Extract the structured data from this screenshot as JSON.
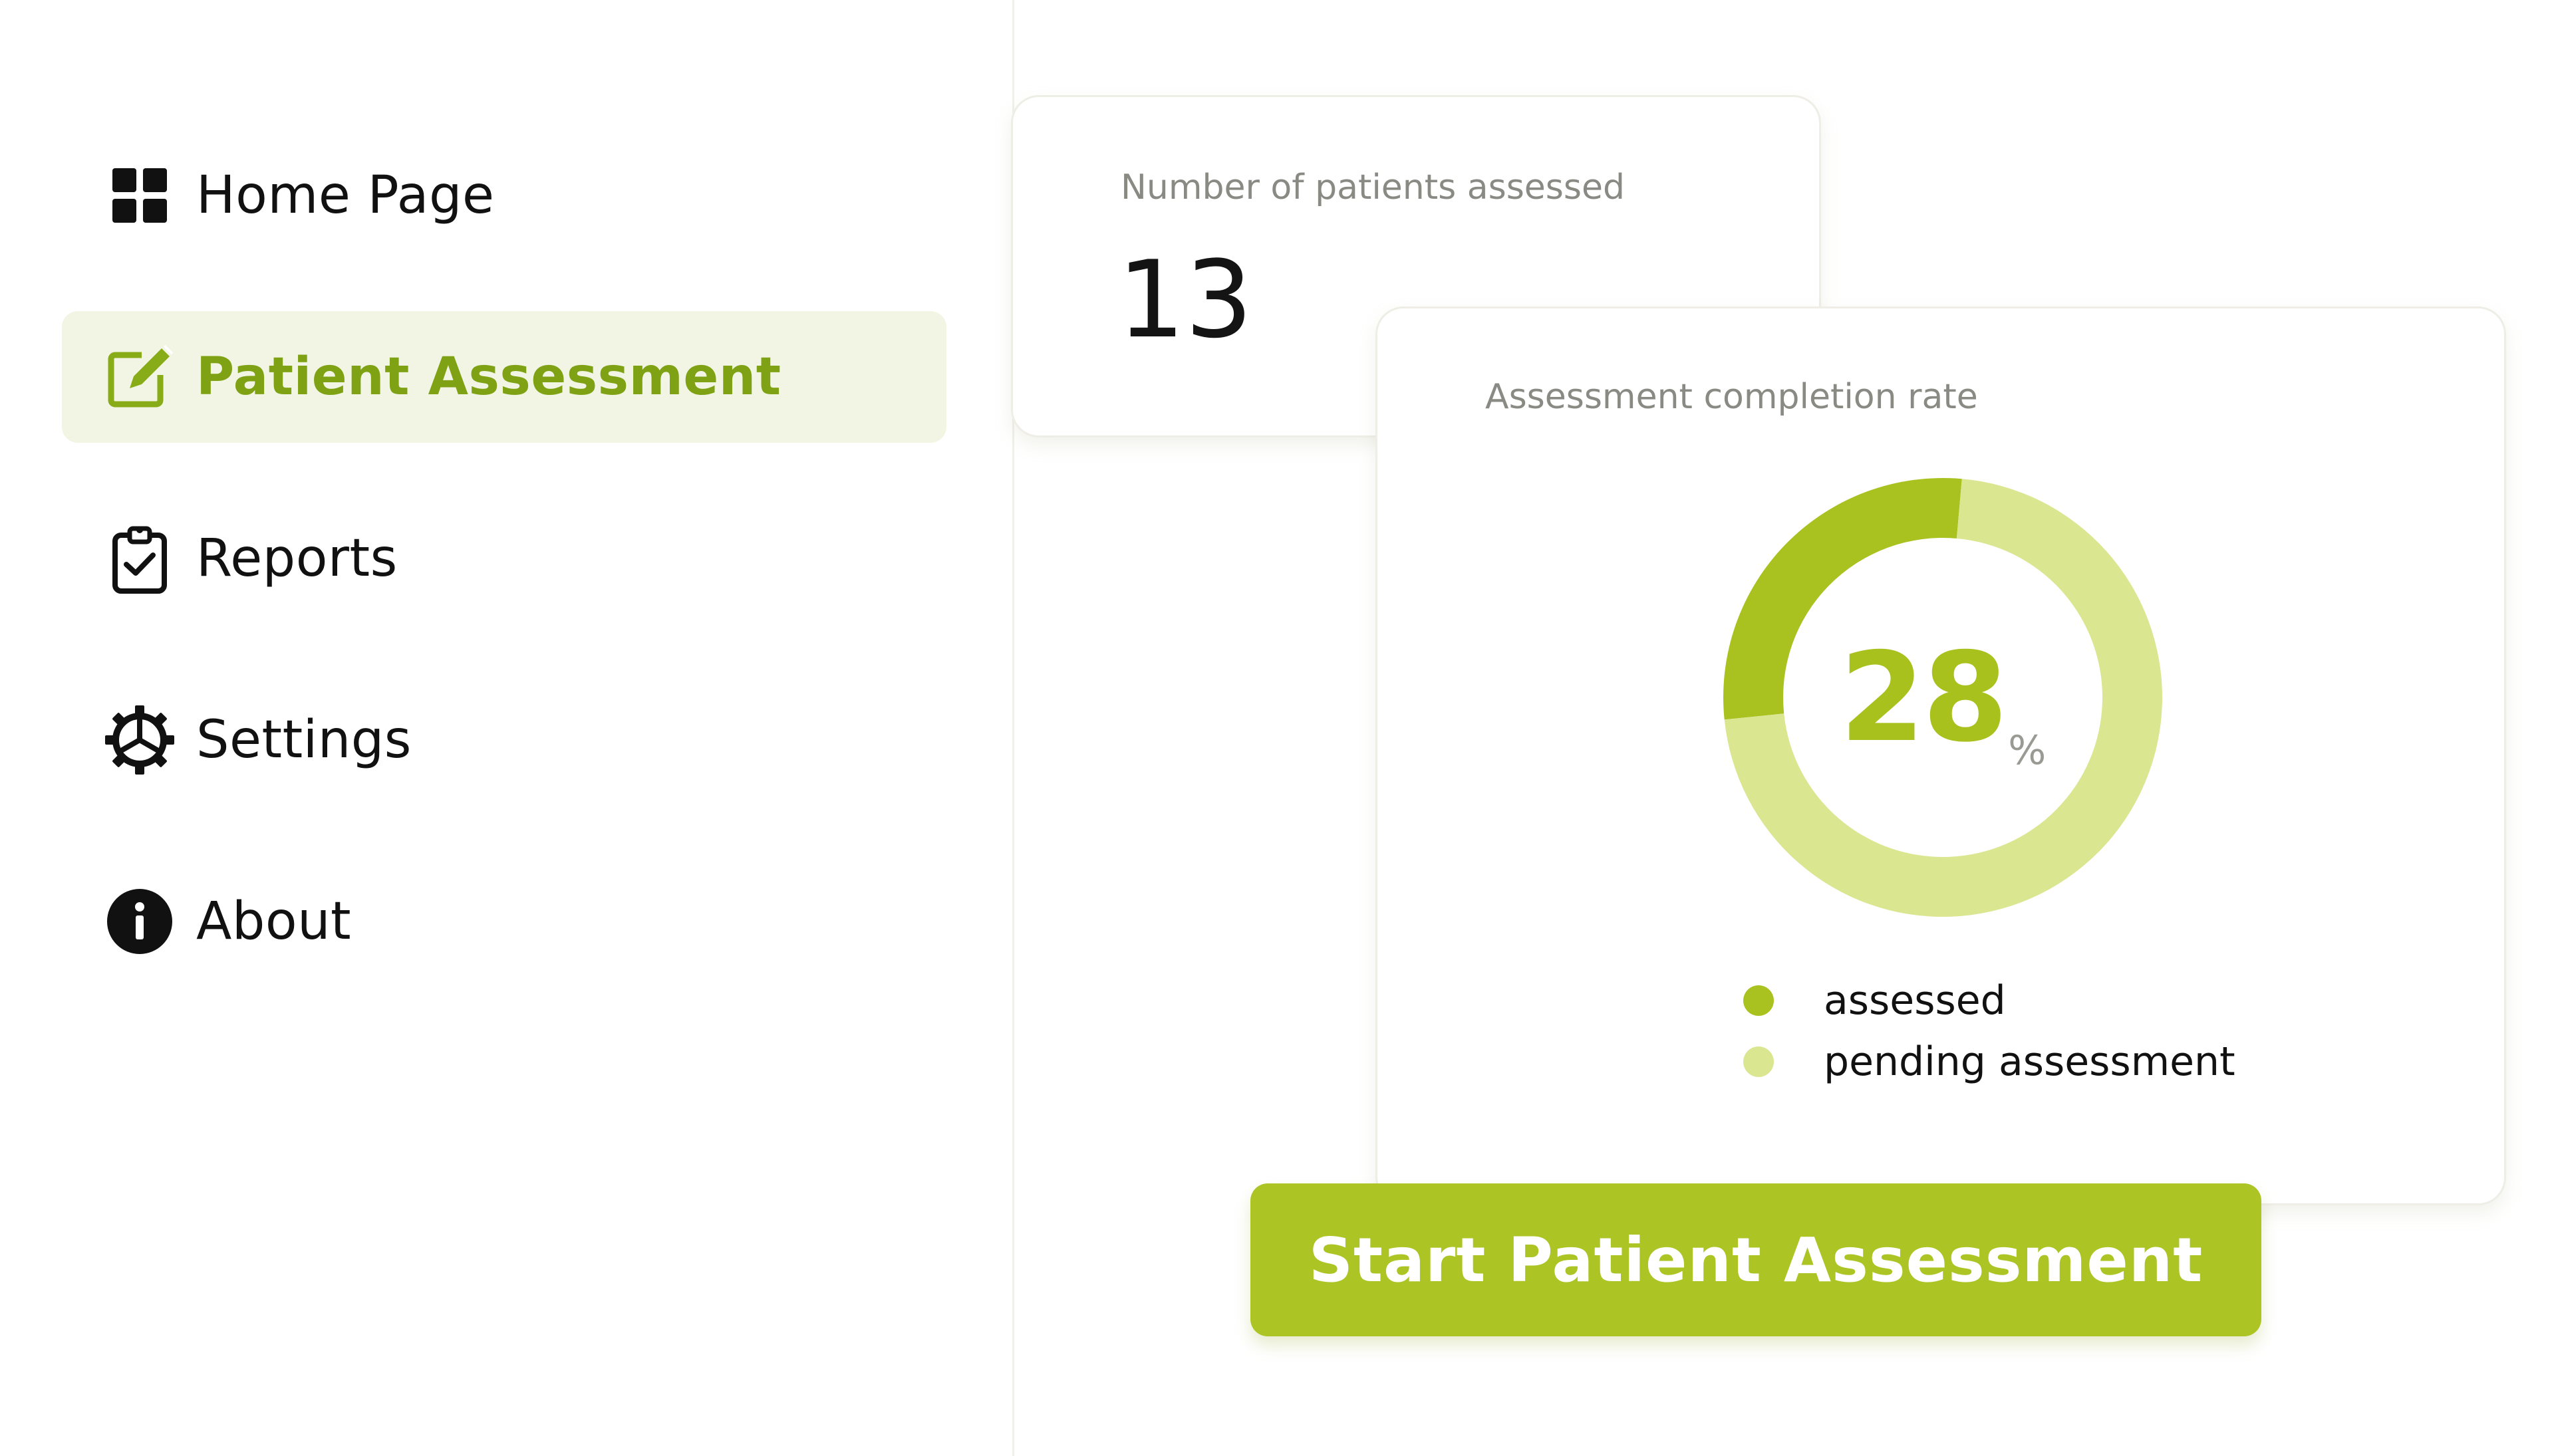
{
  "nav": {
    "items": [
      {
        "label": "Home Page",
        "icon": "grid-icon",
        "active": false
      },
      {
        "label": "Patient Assessment",
        "icon": "edit-icon",
        "active": true
      },
      {
        "label": "Reports",
        "icon": "clipboard-check-icon",
        "active": false
      },
      {
        "label": "Settings",
        "icon": "gear-icon",
        "active": false
      },
      {
        "label": "About",
        "icon": "info-icon",
        "active": false
      }
    ]
  },
  "patients_card": {
    "label": "Number of patients assessed",
    "value": "13"
  },
  "rate_card": {
    "label": "Assessment completion rate",
    "value": "28",
    "unit": "%"
  },
  "chart_data": {
    "type": "pie",
    "style": "donut",
    "categories": [
      "assessed",
      "pending assessment"
    ],
    "values": [
      28,
      72
    ],
    "colors": [
      "#aac21f",
      "#dbe691"
    ],
    "center_label": "28%"
  },
  "legend": {
    "items": [
      {
        "label": "assessed",
        "color": "#aac21f"
      },
      {
        "label": "pending assessment",
        "color": "#dbe691"
      }
    ]
  },
  "actions": {
    "start_label": "Start Patient Assessment"
  },
  "colors": {
    "accent": "#adc425",
    "active_nav_bg": "#f2f5e3",
    "active_nav_text": "#7ea214"
  }
}
